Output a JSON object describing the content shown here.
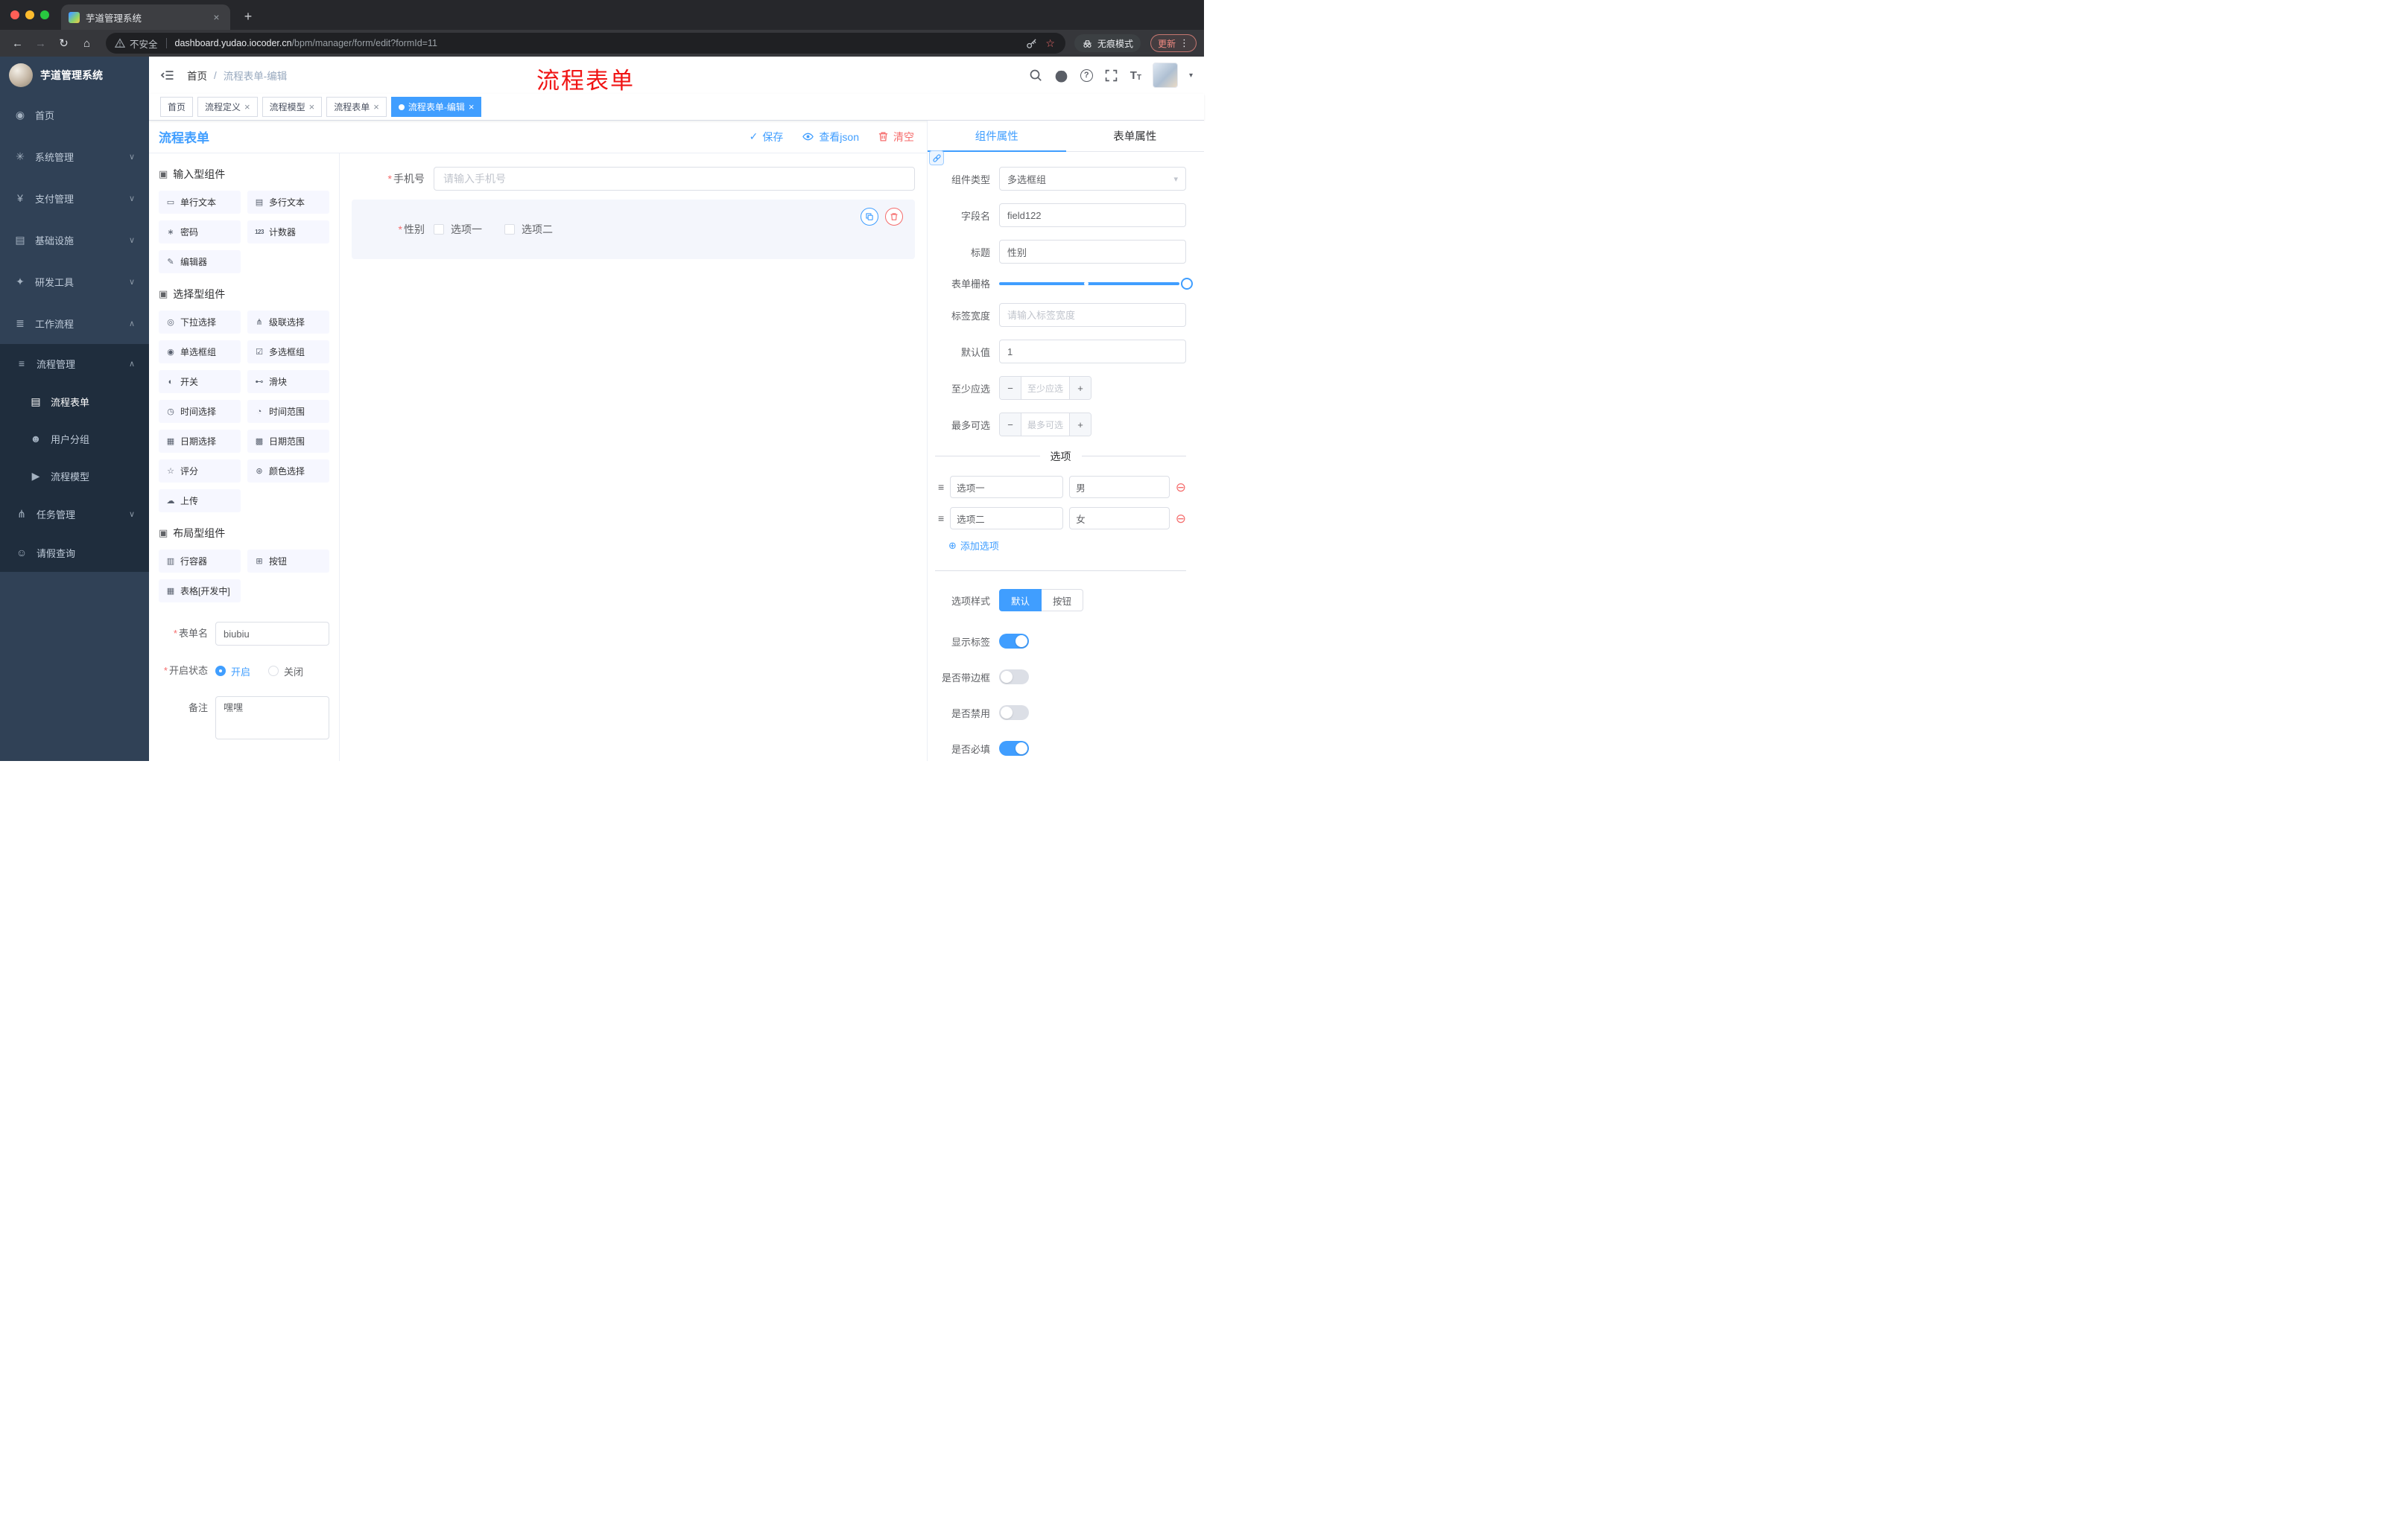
{
  "browser": {
    "tab_title": "芋道管理系统",
    "security_label": "不安全",
    "url_host": "dashboard.yudao.iocoder.cn",
    "url_path": "/bpm/manager/form/edit?formId=11",
    "incognito_label": "无痕模式",
    "update_label": "更新"
  },
  "icons": {
    "back": "←",
    "forward": "→",
    "reload": "↻",
    "home": "⌂",
    "star": "☆",
    "dots": "⋮",
    "new_tab": "+",
    "tab_close": "×",
    "arrow_down": "∨",
    "arrow_up": "∧",
    "chevron_down": "▾",
    "caret_down": "▾",
    "check": "✓",
    "dot": "●",
    "drag": "≡",
    "remove_circle": "⊖",
    "add_circle": "⊕",
    "minus": "−",
    "plus": "+",
    "slash": "/",
    "group_cube": "▣"
  },
  "sidebar": {
    "logo_title": "芋道管理系统",
    "items": [
      {
        "label": "首页",
        "glyph": "◉"
      },
      {
        "label": "系统管理",
        "glyph": "✳"
      },
      {
        "label": "支付管理",
        "glyph": "¥"
      },
      {
        "label": "基础设施",
        "glyph": "▤"
      },
      {
        "label": "研发工具",
        "glyph": "✦"
      },
      {
        "label": "工作流程",
        "glyph": "≣"
      }
    ],
    "process_menu": {
      "label": "流程管理",
      "glyph": "≡"
    },
    "process_children": [
      {
        "label": "流程表单",
        "glyph": "▤"
      },
      {
        "label": "用户分组",
        "glyph": "☻"
      },
      {
        "label": "流程模型",
        "glyph": "▶"
      }
    ],
    "task_menu": {
      "label": "任务管理",
      "glyph": "⋔"
    },
    "leave_item": {
      "label": "请假查询",
      "glyph": "☺"
    }
  },
  "header": {
    "breadcrumb_home": "首页",
    "breadcrumb_current": "流程表单-编辑",
    "annotation": "流程表单"
  },
  "tags": [
    {
      "label": "首页"
    },
    {
      "label": "流程定义"
    },
    {
      "label": "流程模型"
    },
    {
      "label": "流程表单"
    },
    {
      "label": "流程表单-编辑"
    }
  ],
  "editor": {
    "title": "流程表单",
    "toolbar": {
      "save": "保存",
      "view_json": "查看json",
      "clear": "清空"
    },
    "groups": [
      {
        "title": "输入型组件",
        "items": [
          {
            "label": "单行文本",
            "glyph": "▭"
          },
          {
            "label": "多行文本",
            "glyph": "▤"
          },
          {
            "label": "密码",
            "glyph": "∗"
          },
          {
            "label": "计数器",
            "glyph": "123"
          },
          {
            "label": "编辑器",
            "glyph": "✎"
          }
        ]
      },
      {
        "title": "选择型组件",
        "items": [
          {
            "label": "下拉选择",
            "glyph": "◎"
          },
          {
            "label": "级联选择",
            "glyph": "⋔"
          },
          {
            "label": "单选框组",
            "glyph": "◉"
          },
          {
            "label": "多选框组",
            "glyph": "☑"
          },
          {
            "label": "开关",
            "glyph": "◐"
          },
          {
            "label": "滑块",
            "glyph": "⊷"
          },
          {
            "label": "时间选择",
            "glyph": "◷"
          },
          {
            "label": "时间范围",
            "glyph": "◔"
          },
          {
            "label": "日期选择",
            "glyph": "▦"
          },
          {
            "label": "日期范围",
            "glyph": "▩"
          },
          {
            "label": "评分",
            "glyph": "☆"
          },
          {
            "label": "颜色选择",
            "glyph": "⊛"
          },
          {
            "label": "上传",
            "glyph": "☁"
          }
        ]
      },
      {
        "title": "布局型组件",
        "items": [
          {
            "label": "行容器",
            "glyph": "▥"
          },
          {
            "label": "按钮",
            "glyph": "⊞"
          },
          {
            "label": "表格[开发中]",
            "glyph": "▦"
          }
        ]
      }
    ],
    "meta": {
      "name_label": "表单名",
      "name_value": "biubiu",
      "status_label": "开启状态",
      "status_on": "开启",
      "status_off": "关闭",
      "remark_label": "备注",
      "remark_value": "嘿嘿"
    },
    "canvas": {
      "phone_label": "手机号",
      "phone_placeholder": "请输入手机号",
      "gender_label": "性别",
      "gender_option1": "选项一",
      "gender_option2": "选项二"
    }
  },
  "props": {
    "tab_component": "组件属性",
    "tab_form": "表单属性",
    "type_label": "组件类型",
    "type_value": "多选框组",
    "field_label": "字段名",
    "field_value": "field122",
    "title_label": "标题",
    "title_value": "性别",
    "grid_label": "表单栅格",
    "width_label": "标签宽度",
    "width_placeholder": "请输入标签宽度",
    "default_label": "默认值",
    "default_value": "1",
    "min_label": "至少应选",
    "min_placeholder": "至少应选",
    "max_label": "最多可选",
    "max_placeholder": "最多可选",
    "options_divider": "选项",
    "options": [
      {
        "label": "选项一",
        "value": "男"
      },
      {
        "label": "选项二",
        "value": "女"
      }
    ],
    "add_option": "添加选项",
    "style_label": "选项样式",
    "style_default": "默认",
    "style_button": "按钮",
    "switches": [
      {
        "label": "显示标签",
        "on": true
      },
      {
        "label": "是否带边框",
        "on": false
      },
      {
        "label": "是否禁用",
        "on": false
      },
      {
        "label": "是否必填",
        "on": true
      }
    ]
  },
  "colors": {
    "primary": "#409eff",
    "danger": "#f56c6c",
    "annotation": "#f01414"
  }
}
